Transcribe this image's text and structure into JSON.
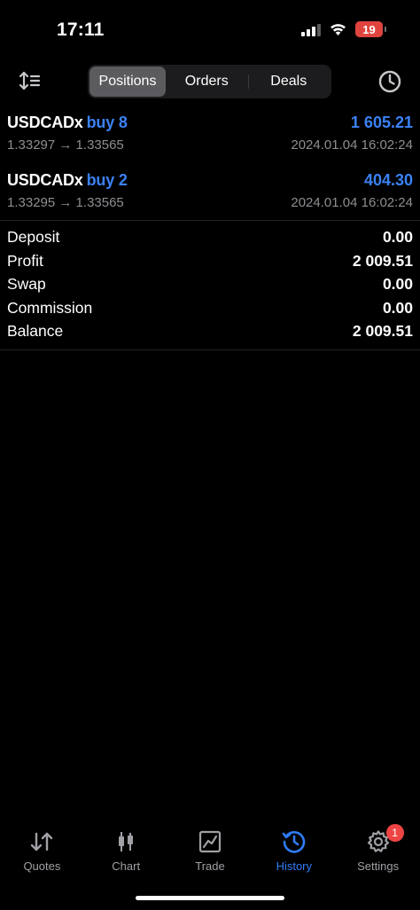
{
  "status_bar": {
    "time": "17:11",
    "battery": "19"
  },
  "toolbar": {
    "segments": [
      "Positions",
      "Orders",
      "Deals"
    ],
    "active_segment": "Positions"
  },
  "positions": [
    {
      "symbol": "USDCADx",
      "type": "buy 8",
      "profit": "1 605.21",
      "prices": "1.33297 → 1.33565",
      "time": "2024.01.04 16:02:24"
    },
    {
      "symbol": "USDCADx",
      "type": "buy 2",
      "profit": "404.30",
      "prices": "1.33295 → 1.33565",
      "time": "2024.01.04 16:02:24"
    }
  ],
  "summary": [
    {
      "label": "Deposit",
      "value": "0.00"
    },
    {
      "label": "Profit",
      "value": "2 009.51"
    },
    {
      "label": "Swap",
      "value": "0.00"
    },
    {
      "label": "Commission",
      "value": "0.00"
    },
    {
      "label": "Balance",
      "value": "2 009.51"
    }
  ],
  "tabbar": {
    "items": [
      {
        "label": "Quotes",
        "icon": "quotes-arrows-icon"
      },
      {
        "label": "Chart",
        "icon": "candlestick-icon"
      },
      {
        "label": "Trade",
        "icon": "trade-chart-icon"
      },
      {
        "label": "History",
        "icon": "history-clock-icon"
      },
      {
        "label": "Settings",
        "icon": "gear-icon",
        "badge": "1"
      }
    ],
    "active": "History"
  },
  "colors": {
    "accent": "#3b82f6",
    "background": "#000000",
    "secondary_text": "#8e8e93",
    "badge": "#ef4444"
  }
}
